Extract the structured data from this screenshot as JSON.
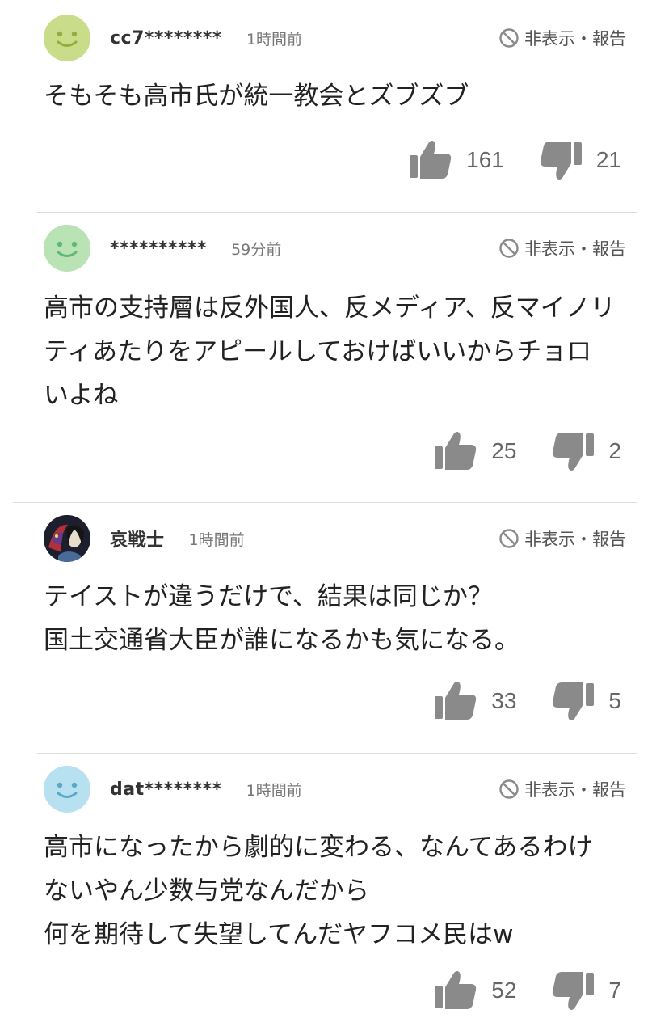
{
  "hide_report_label": "非表示・報告",
  "comments": [
    {
      "user": "cc7********",
      "time": "1時間前",
      "text": "そもそも高市氏が統一教会とズブズブ",
      "likes": "161",
      "dislikes": "21",
      "avatar": {
        "type": "smiley",
        "color": "#c9dc8a"
      }
    },
    {
      "user": "**********",
      "time": "59分前",
      "text": "高市の支持層は反外国人、反メディア、反マイノリ\nティあたりをアピールしておけばいいからチョロ\nいよね",
      "likes": "25",
      "dislikes": "2",
      "avatar": {
        "type": "smiley",
        "color": "#b9e3b4"
      }
    },
    {
      "user": "哀戦士",
      "time": "1時間前",
      "text": "テイストが違うだけで、結果は同じか？\n国土交通省大臣が誰になるかも気になる。",
      "likes": "33",
      "dislikes": "5",
      "avatar": {
        "type": "illustration",
        "color": "#2a2a3a"
      }
    },
    {
      "user": "dat********",
      "time": "1時間前",
      "text": "高市になったから劇的に変わる、なんてあるわけ\nないやん少数与党なんだから\n何を期待して失望してんだヤフコメ民はw",
      "likes": "52",
      "dislikes": "7",
      "avatar": {
        "type": "smiley",
        "color": "#b7e0f0"
      }
    }
  ],
  "icons": {
    "ban": "ban-icon",
    "like": "thumbs-up-icon",
    "dislike": "thumbs-down-icon"
  },
  "colors": {
    "icon_gray": "#8a8a8a",
    "divider": "#dcdcdc"
  }
}
